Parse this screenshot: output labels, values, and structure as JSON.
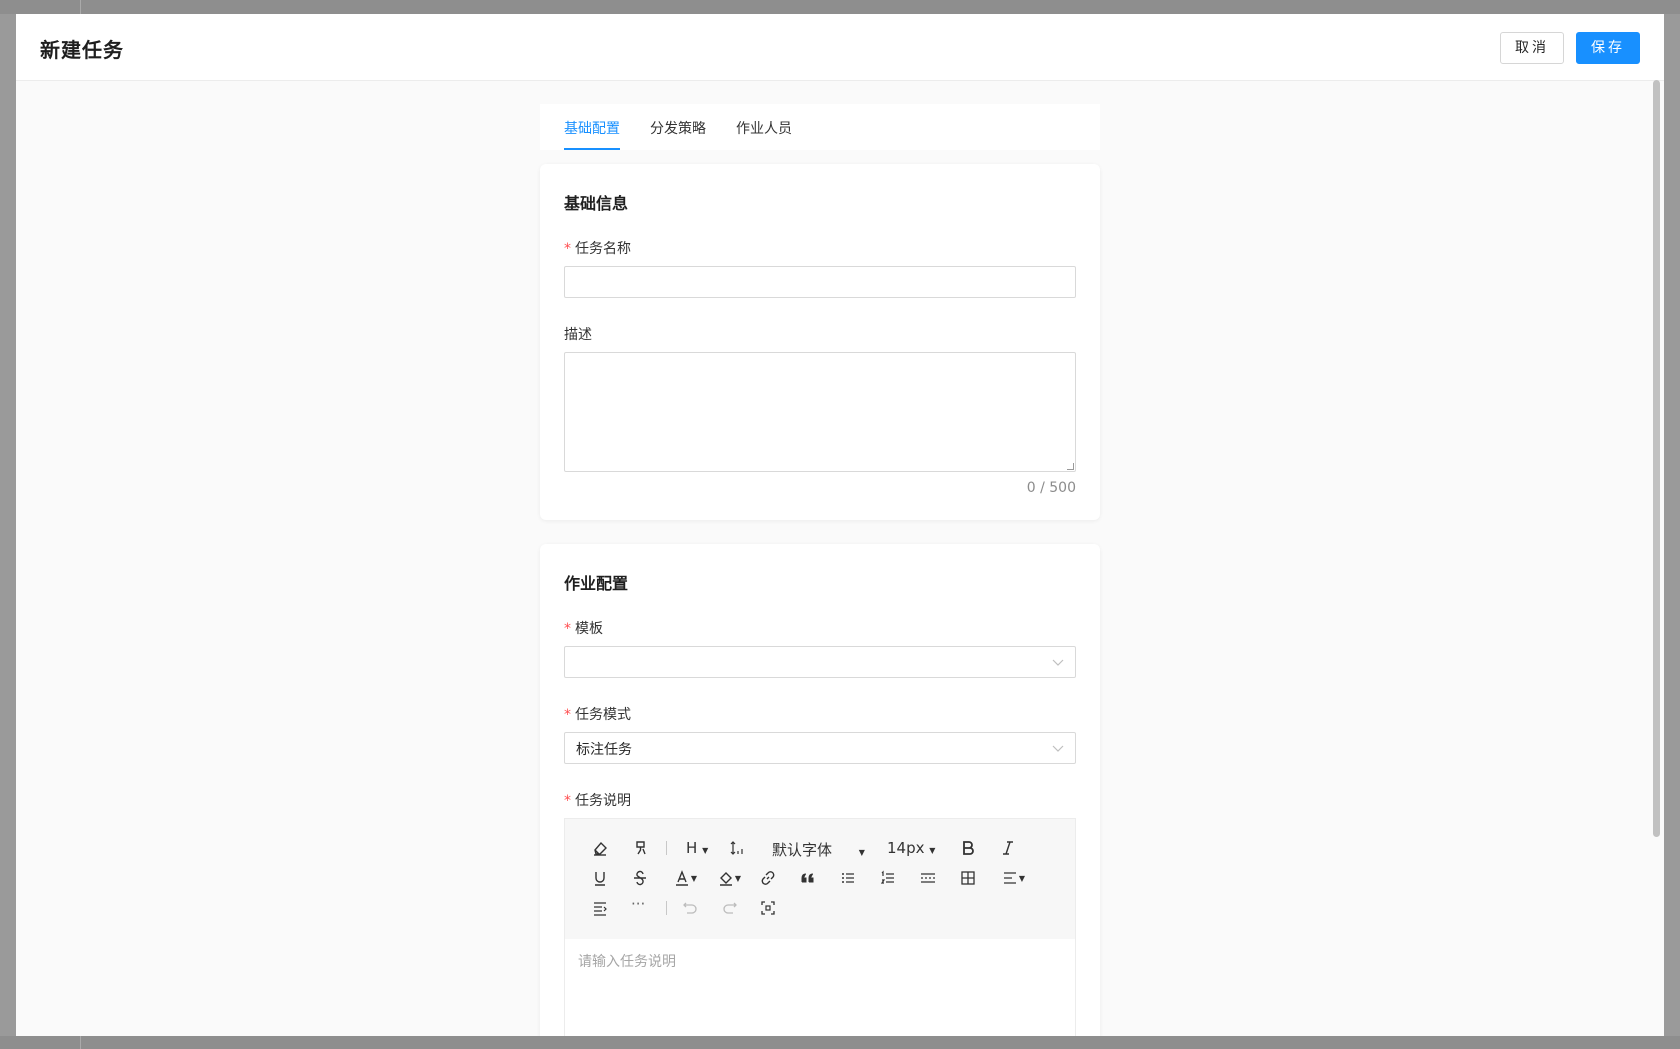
{
  "modal": {
    "title": "新建任务",
    "cancel_label": "取消",
    "save_label": "保存"
  },
  "tabs": [
    {
      "label": "基础配置",
      "active": true
    },
    {
      "label": "分发策略",
      "active": false
    },
    {
      "label": "作业人员",
      "active": false
    }
  ],
  "basic_info": {
    "title": "基础信息",
    "name_label": "任务名称",
    "name_value": "",
    "desc_label": "描述",
    "desc_value": "",
    "desc_counter": "0 / 500"
  },
  "job_config": {
    "title": "作业配置",
    "template_label": "模板",
    "template_value": "",
    "mode_label": "任务模式",
    "mode_value": "标注任务",
    "instructions_label": "任务说明",
    "instructions_placeholder": "请输入任务说明"
  },
  "editor_toolbar": {
    "font_family": "默认字体",
    "font_size": "14px",
    "heading": "H",
    "more": "···"
  },
  "colors": {
    "accent": "#1890ff",
    "required": "#ff4d4f"
  }
}
